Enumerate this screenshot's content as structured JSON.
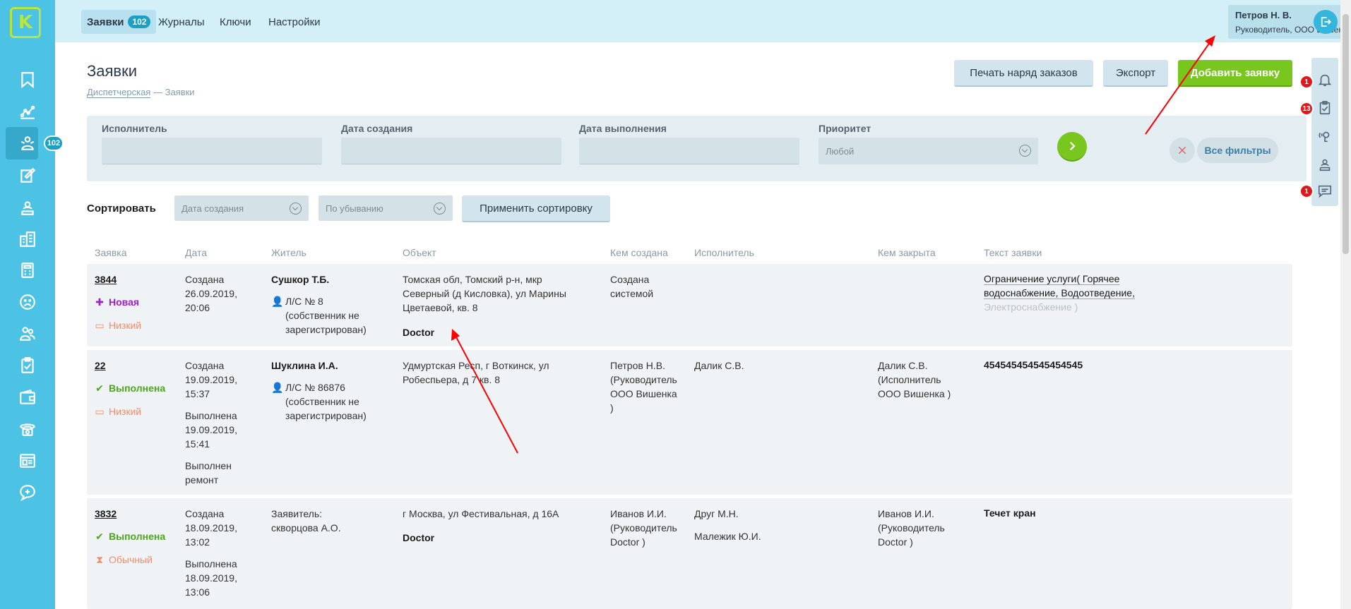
{
  "sidebar": {
    "logo": "K",
    "badge": "102"
  },
  "topnav": {
    "tabs": [
      {
        "label": "Заявки",
        "badge": "102"
      },
      {
        "label": "Журналы"
      },
      {
        "label": "Ключи"
      },
      {
        "label": "Настройки"
      }
    ],
    "user_name": "Петров Н. В.",
    "user_role": "Руководитель, ООО Вишенка"
  },
  "page": {
    "title": "Заявки",
    "breadcrumb_root": "Диспетчерская",
    "breadcrumb_sep": "—",
    "breadcrumb_current": "Заявки"
  },
  "actions": {
    "print_label": "Печать наряд заказов",
    "export_label": "Экспорт",
    "add_label": "Добавить заявку"
  },
  "right_panel": {
    "bell_count": "1",
    "tasks_count": "13",
    "chat_count": "1"
  },
  "filters": {
    "executor_label": "Исполнитель",
    "created_label": "Дата создания",
    "done_label": "Дата выполнения",
    "priority_label": "Приоритет",
    "priority_value": "Любой",
    "all_filters_label": "Все фильтры"
  },
  "sort": {
    "label": "Сортировать",
    "field_value": "Дата создания",
    "order_value": "По убыванию",
    "apply_label": "Применить сортировку"
  },
  "table": {
    "headers": [
      "Заявка",
      "Дата",
      "Житель",
      "Объект",
      "Кем создана",
      "Исполнитель",
      "Кем закрыта",
      "Текст заявки"
    ],
    "rows": [
      {
        "id": "3844",
        "status": "Новая",
        "priority": "Низкий",
        "date_lines": [
          "Создана",
          "26.09.2019,",
          "20:06"
        ],
        "resident_name": "Сушкор Т.Б.",
        "resident_account": [
          "Л/С № 8",
          "(собственник не",
          "зарегистрирован)"
        ],
        "object_lines": [
          "Томская обл, Томский р-н, мкр",
          "Северный (д Кисловка), ул Марины",
          "Цветаевой, кв. 8"
        ],
        "object_org": "Doctor",
        "created_by": [
          "Создана",
          "системой"
        ],
        "executor": [],
        "closed_by": [],
        "text_lines": [
          "Ограничение услуги( Горячее",
          "водоснабжение, Водоотведение,",
          "Электроснабжение )"
        ]
      },
      {
        "id": "22",
        "status": "Выполнена",
        "priority": "Низкий",
        "date_lines": [
          "Создана",
          "19.09.2019,",
          "15:37",
          "Выполнена",
          "19.09.2019,",
          "15:41",
          "Выполнен",
          "ремонт"
        ],
        "resident_name": "Шуклина И.А.",
        "resident_account": [
          "Л/С № 86876",
          "(собственник не",
          "зарегистрирован)"
        ],
        "object_lines": [
          "Удмуртская Респ, г Воткинск, ул",
          "Робеспьера, д 7 кв. 8"
        ],
        "object_org": "",
        "created_by": [
          "Петров Н.В.",
          "(Руководитель",
          "ООО Вишенка",
          ")"
        ],
        "executor": [
          "Далик С.В."
        ],
        "closed_by": [
          "Далик С.В.",
          "(Исполнитель",
          "ООО Вишенка )"
        ],
        "text_lines": [
          "454545454545454545"
        ]
      },
      {
        "id": "3832",
        "status": "Выполнена",
        "priority": "Обычный",
        "date_lines": [
          "Создана",
          "18.09.2019,",
          "13:02",
          "Выполнена",
          "18.09.2019,",
          "13:06"
        ],
        "resident_name": "Заявитель:",
        "resident_account": [
          "скворцова А.О."
        ],
        "object_lines": [
          "г Москва, ул Фестивальная, д 16А"
        ],
        "object_org": "Doctor",
        "created_by": [
          "Иванов И.И.",
          "(Руководитель",
          "Doctor )"
        ],
        "executor": [
          "Друг М.Н.",
          "Малежик Ю.И."
        ],
        "closed_by": [
          "Иванов И.И.",
          "(Руководитель",
          "Doctor )"
        ],
        "text_lines": [
          "Течет кран"
        ]
      }
    ]
  },
  "colors": {
    "sidebar": "#4cc2e4",
    "accent_green": "#79c61e",
    "badge_red": "#e0181b",
    "annotation": "#ff0000"
  }
}
